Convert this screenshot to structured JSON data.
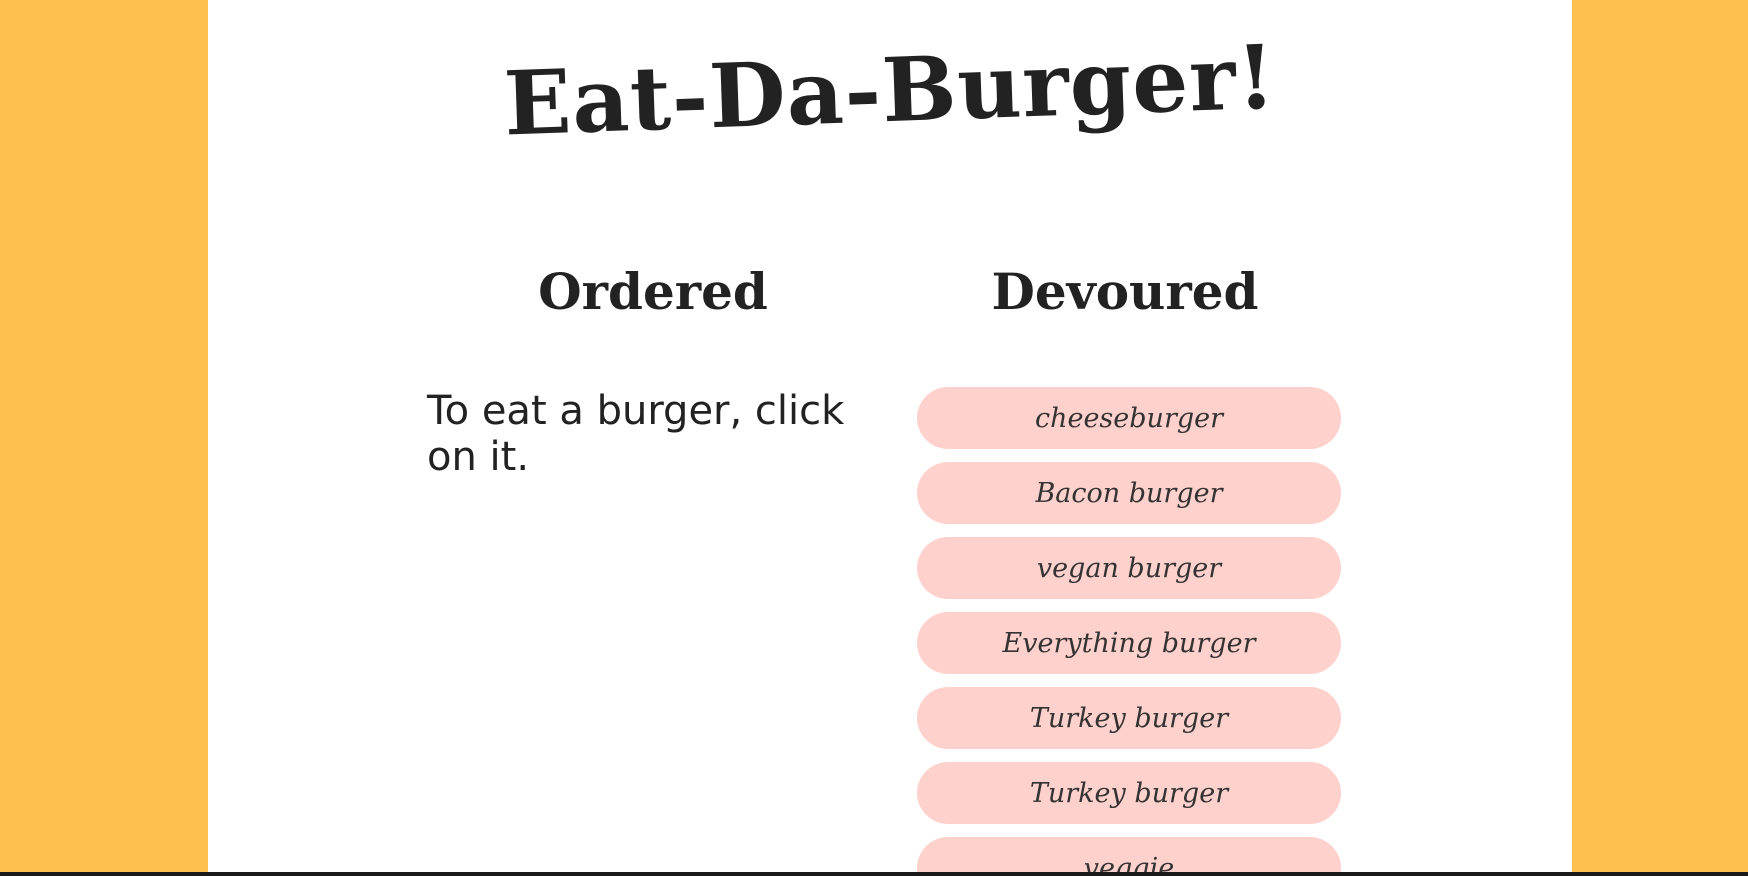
{
  "app": {
    "title": "Eat-Da-Burger!"
  },
  "columns": {
    "ordered": {
      "heading": "Ordered",
      "hint": "To eat a burger, click on it."
    },
    "devoured": {
      "heading": "Devoured",
      "items": [
        "cheeseburger",
        "Bacon burger",
        "vegan burger",
        "Everything burger",
        "Turkey burger",
        "Turkey burger",
        "veggie"
      ]
    }
  },
  "colors": {
    "background": "#fec04e",
    "panel": "#ffffff",
    "burger_pill": "#ffd1cc",
    "text": "#222222"
  }
}
